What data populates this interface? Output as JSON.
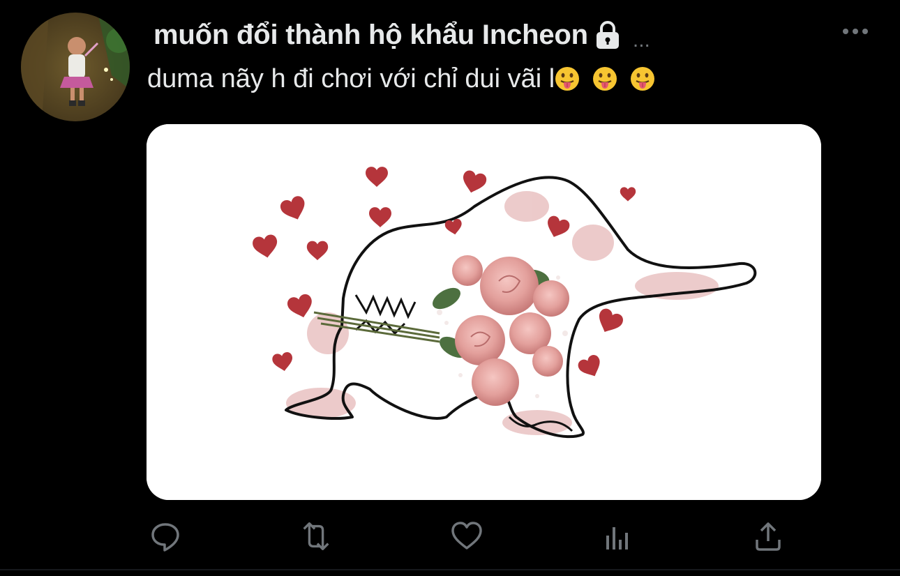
{
  "tweet": {
    "display_name": "muốn đổi thành hộ khẩu Incheon",
    "protected_icon": "lock-icon",
    "handle": "...",
    "text": "duma nãy h đi chơi với chỉ dui vãi l",
    "emojis": [
      "face-with-tongue",
      "face-with-tongue",
      "face-with-tongue"
    ],
    "media_description_icon": "dinosaur-drawing-with-roses-and-hearts"
  },
  "actions": [
    {
      "name": "reply",
      "icon": "reply-icon"
    },
    {
      "name": "retweet",
      "icon": "retweet-icon"
    },
    {
      "name": "like",
      "icon": "heart-icon"
    },
    {
      "name": "analytics",
      "icon": "analytics-icon"
    },
    {
      "name": "share",
      "icon": "share-icon"
    }
  ],
  "colors": {
    "background": "#000000",
    "text_primary": "#e7e9ea",
    "text_secondary": "#71767b",
    "heart_red": "#b5353b",
    "rose_pink": "#e8a3a0"
  }
}
